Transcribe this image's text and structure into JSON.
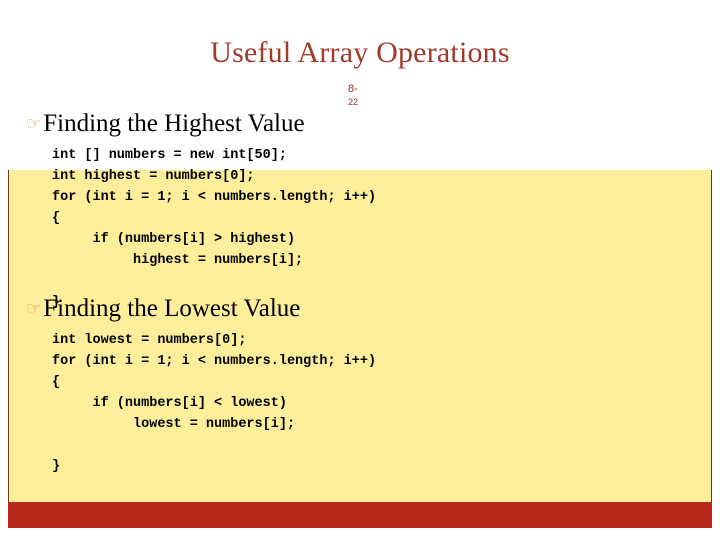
{
  "slide": {
    "title": "Useful Array Operations",
    "number_line_1": "8-",
    "number_line_2": "22",
    "bullet_glyph": "☞",
    "colors": {
      "title": "#a03a2b",
      "header_gradient_top": "#32a8a4",
      "header_gradient_bottom": "#ffffff",
      "body_panel": "#fdee9c",
      "bottom_bar": "#b5281a",
      "panel_border": "#6b3a16",
      "bullet": "#dfa068",
      "code_text": "#000000",
      "heading_text": "#000000"
    }
  },
  "sections": [
    {
      "heading": "Finding the Highest Value",
      "code": [
        "int [] numbers = new int[50];",
        "int highest = numbers[0];",
        "for (int i = 1; i < numbers.length; i++)",
        "{",
        "     if (numbers[i] > highest)",
        "          highest = numbers[i];",
        "",
        "}"
      ]
    },
    {
      "heading": "Finding the Lowest Value",
      "code": [
        "int lowest = numbers[0];",
        "for (int i = 1; i < numbers.length; i++)",
        "{",
        "     if (numbers[i] < lowest)",
        "          lowest = numbers[i];",
        "",
        "}"
      ]
    }
  ]
}
